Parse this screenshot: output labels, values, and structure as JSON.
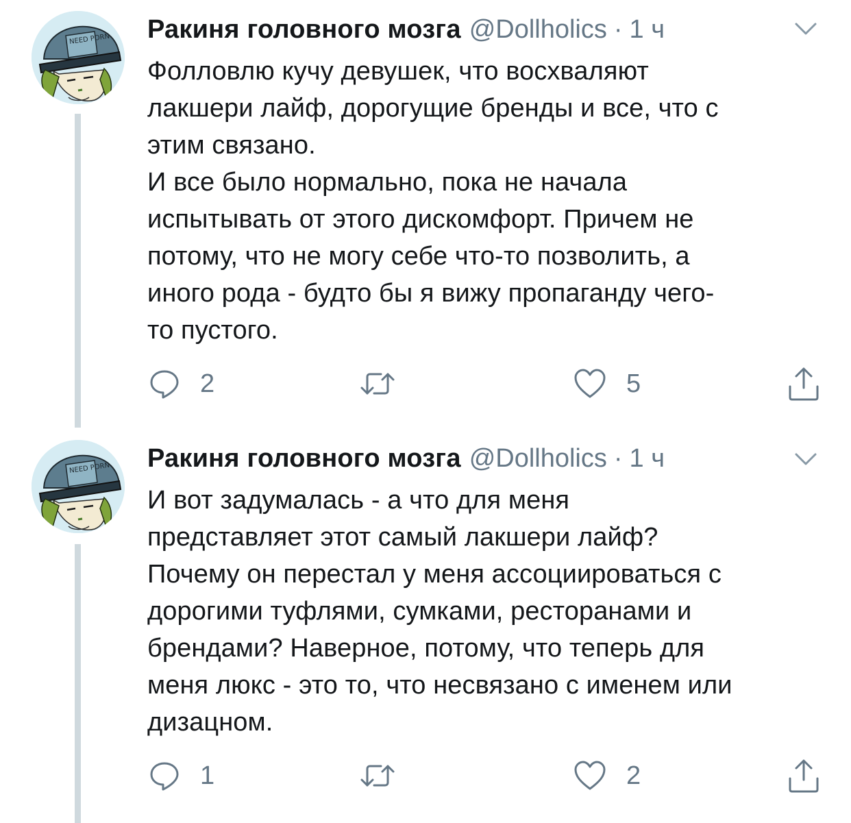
{
  "tweets": [
    {
      "author": {
        "display_name": "Ракиня головного мозга",
        "handle": "@Dollholics",
        "avatar_text": "NEED PORN"
      },
      "separator": "·",
      "time": "1 ч",
      "text": "Фолловлю кучу девушек, что восхваляют\nлакшери лайф, дорогущие бренды и все, что с\nэтим связано.\nИ все было нормально, пока не начала\nиспытывать от этого дискомфорт. Причем не\nпотому, что не могу себе что-то позволить, а\nиного рода - будто бы я вижу пропаганду чего-\nто пустого.",
      "actions": {
        "reply_count": "2",
        "retweet_count": "",
        "like_count": "5"
      },
      "icons": {
        "reply": "reply-icon",
        "retweet": "retweet-icon",
        "like": "heart-icon",
        "share": "share-icon",
        "menu": "chevron-down-icon"
      }
    },
    {
      "author": {
        "display_name": "Ракиня головного мозга",
        "handle": "@Dollholics",
        "avatar_text": "NEED PORN"
      },
      "separator": "·",
      "time": "1 ч",
      "text": "И вот задумалась - а что для меня\nпредставляет этот самый лакшери лайф?\nПочему он перестал у меня ассоциироваться с\nдорогими туфлями, сумками, ресторанами и\nбрендами?  Наверное, потому, что теперь для\nменя люкс - это то, что несвязано с именем или\nдизацном.",
      "actions": {
        "reply_count": "1",
        "retweet_count": "",
        "like_count": "2"
      },
      "icons": {
        "reply": "reply-icon",
        "retweet": "retweet-icon",
        "like": "heart-icon",
        "share": "share-icon",
        "menu": "chevron-down-icon"
      }
    }
  ],
  "colors": {
    "text_primary": "#14171a",
    "text_secondary": "#657786",
    "thread_line": "#cfd9de",
    "background": "#ffffff"
  }
}
